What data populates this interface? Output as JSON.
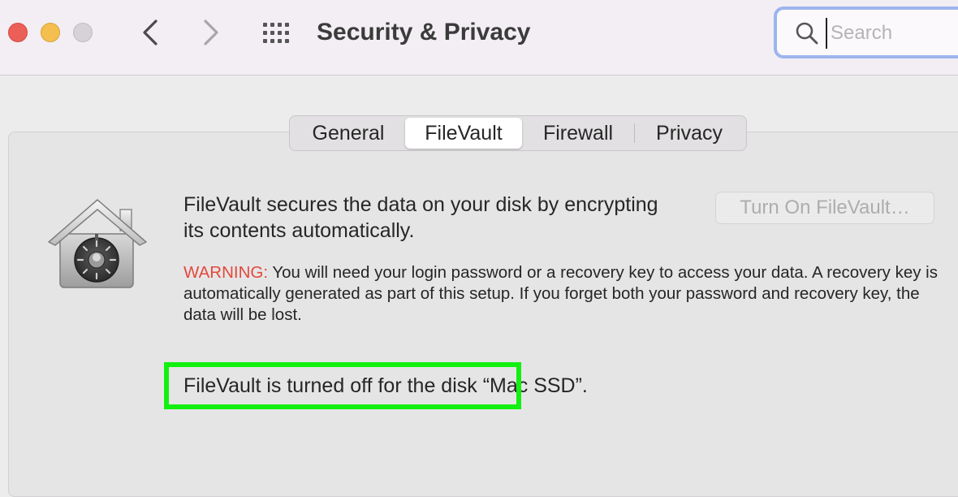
{
  "window": {
    "title": "Security & Privacy",
    "traffic_lights": {
      "close_color": "#ec5f58",
      "minimize_color": "#f4bf4f",
      "zoom_color": "#d6d2d7"
    }
  },
  "toolbar": {
    "back_icon": "chevron-left-icon",
    "forward_icon": "chevron-right-icon",
    "show_all_icon": "grid-icon"
  },
  "search": {
    "placeholder": "Search",
    "value": "",
    "icon": "search-icon",
    "focus_color": "#9db4ee"
  },
  "tabs": [
    {
      "label": "General",
      "selected": false
    },
    {
      "label": "FileVault",
      "selected": true
    },
    {
      "label": "Firewall",
      "selected": false
    },
    {
      "label": "Privacy",
      "selected": false
    }
  ],
  "filevault": {
    "icon": "filevault-house-icon",
    "description": "FileVault secures the data on your disk by encrypting its contents automatically.",
    "turn_on_button": "Turn On FileVault…",
    "turn_on_enabled": false,
    "warning_label": "WARNING:",
    "warning_text": " You will need your login password or a recovery key to access your data. A recovery key is automatically generated as part of this setup. If you forget both your password and recovery key, the data will be lost.",
    "status_text": "FileVault is turned off for the disk “Mac SSD”.",
    "warning_color": "#e2493b",
    "highlight_color": "#12f010"
  }
}
